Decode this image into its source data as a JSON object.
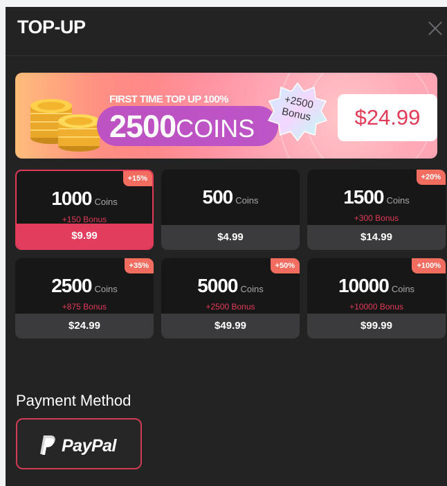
{
  "header": {
    "title": "TOP-UP"
  },
  "banner": {
    "headline": "FIRST TIME TOP UP 100%",
    "coins_number": "2500",
    "coins_word": "COINS",
    "badge_line1": "+2500",
    "badge_line2": "Bonus",
    "price": "$24.99"
  },
  "packages": [
    {
      "amount": "1000",
      "unit": "Coins",
      "bonus": "+150 Bonus",
      "price": "$9.99",
      "tag": "+15%",
      "selected": true
    },
    {
      "amount": "500",
      "unit": "Coins",
      "bonus": "",
      "price": "$4.99",
      "tag": "",
      "selected": false
    },
    {
      "amount": "1500",
      "unit": "Coins",
      "bonus": "+300 Bonus",
      "price": "$14.99",
      "tag": "+20%",
      "selected": false
    },
    {
      "amount": "2500",
      "unit": "Coins",
      "bonus": "+875 Bonus",
      "price": "$24.99",
      "tag": "+35%",
      "selected": false
    },
    {
      "amount": "5000",
      "unit": "Coins",
      "bonus": "+2500 Bonus",
      "price": "$49.99",
      "tag": "+50%",
      "selected": false
    },
    {
      "amount": "10000",
      "unit": "Coins",
      "bonus": "+10000 Bonus",
      "price": "$99.99",
      "tag": "+100%",
      "selected": false
    }
  ],
  "payment": {
    "title": "Payment Method",
    "method_label": "PayPal"
  },
  "colors": {
    "accent": "#e23a58",
    "background": "#232324",
    "card": "#171717",
    "tag": "#f26d5f"
  },
  "icons": {
    "close": "close-icon",
    "coins": "gold-coins-icon",
    "paypal": "paypal-logo-icon"
  }
}
